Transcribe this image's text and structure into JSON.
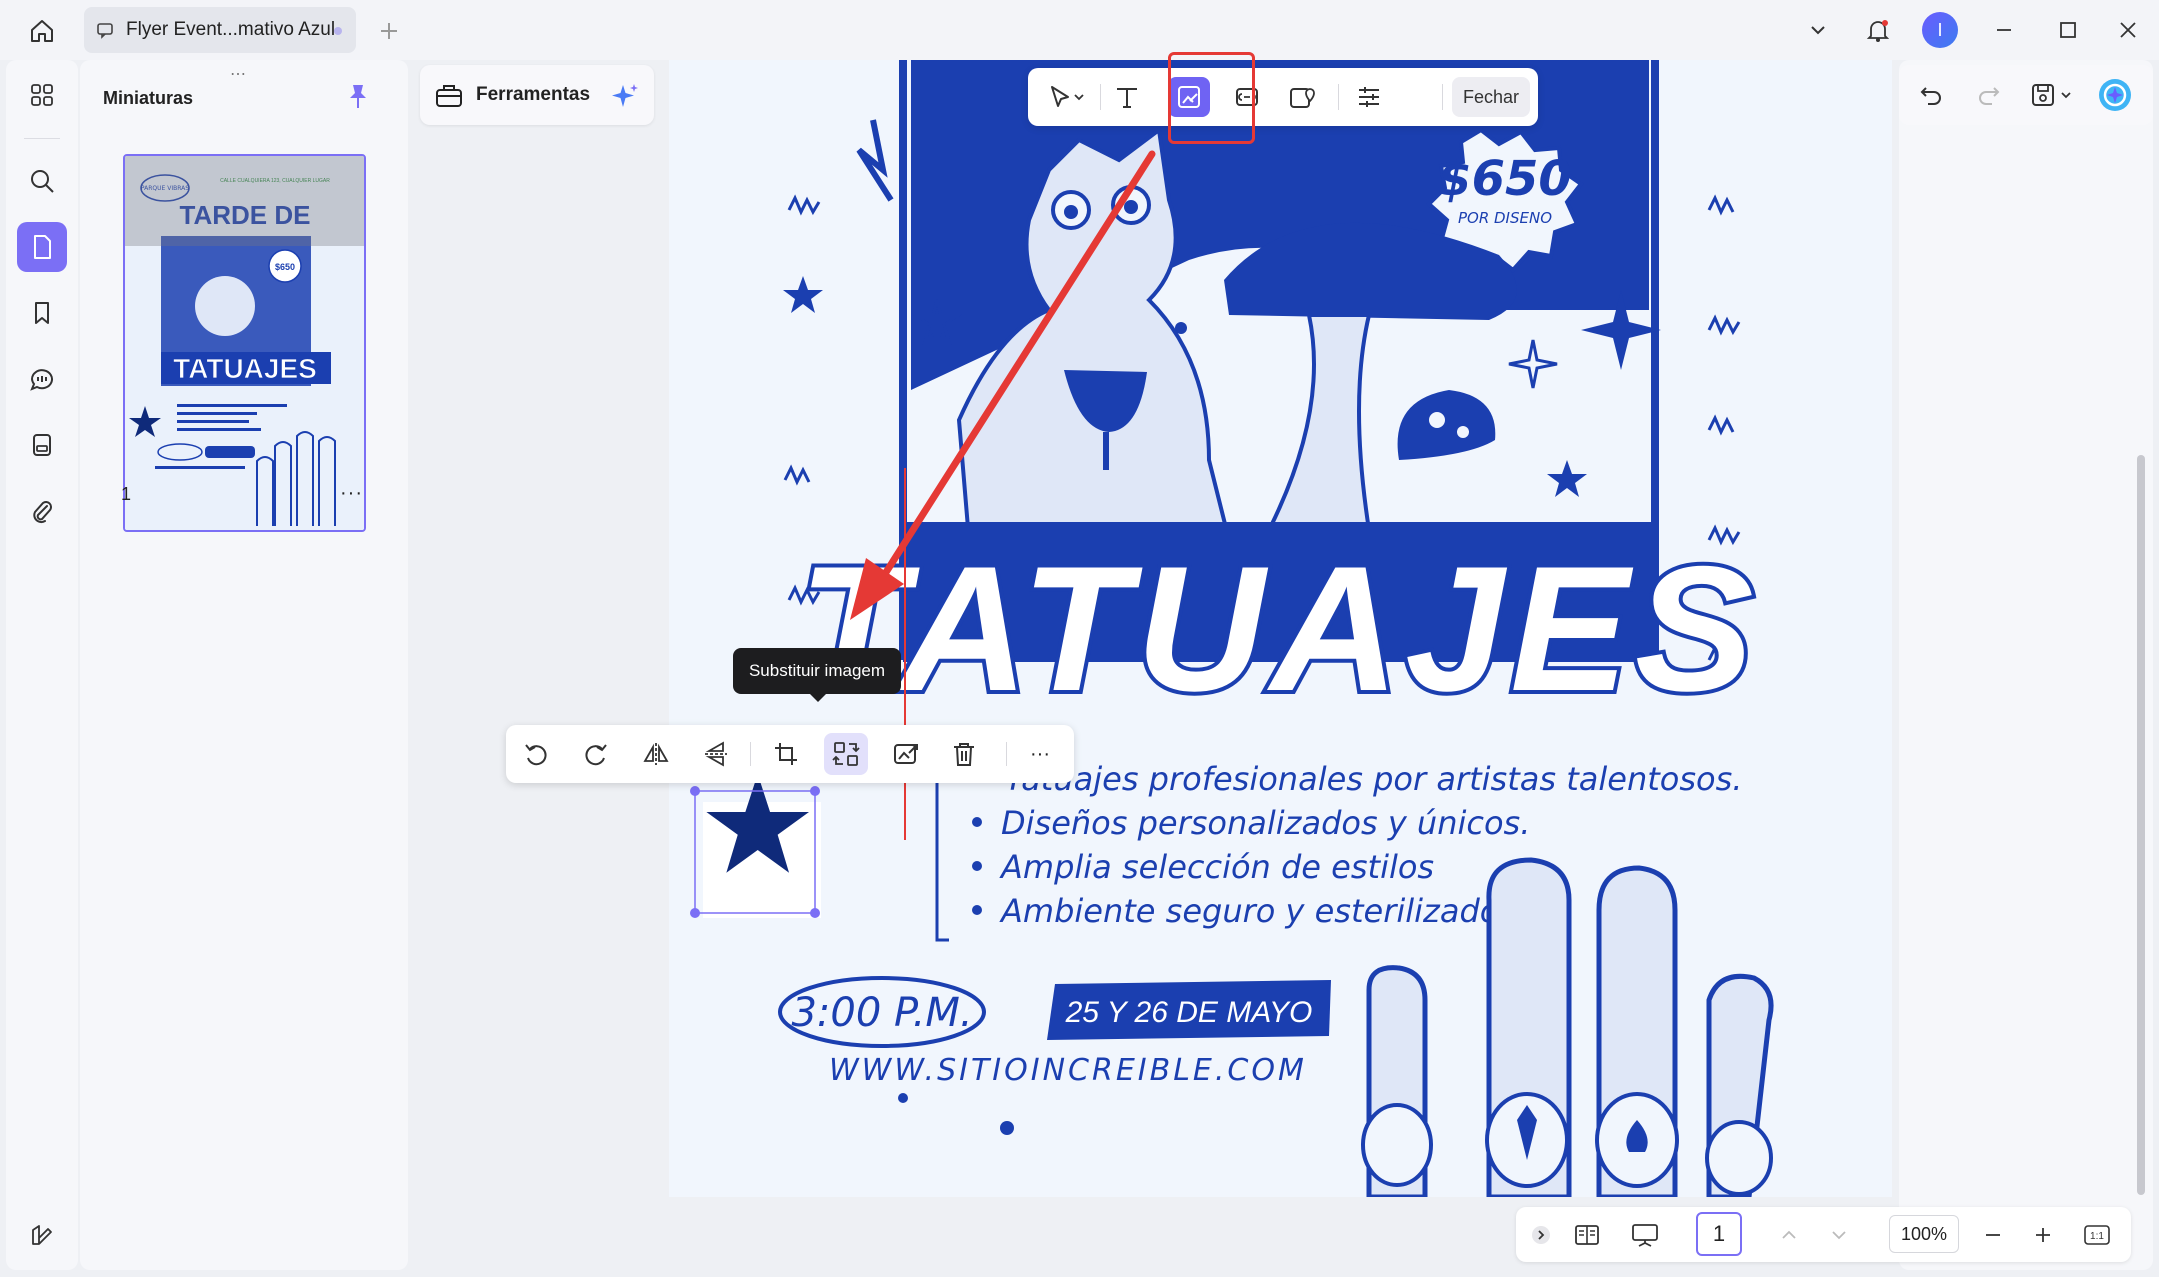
{
  "titlebar": {
    "tab_title": "Flyer Event...mativo Azul",
    "avatar_letter": "I"
  },
  "sidebar": {
    "panel_title": "Miniaturas",
    "page_number": "1",
    "more": "···"
  },
  "tools": {
    "label": "Ferramentas"
  },
  "edit_toolbar": {
    "close_label": "Fechar",
    "active_tool": "edit-image"
  },
  "image_toolbar": {
    "tooltip": "Substituir imagem",
    "more": "···"
  },
  "flyer": {
    "thumb_tag": "PARQUE VIBRAS",
    "thumb_address": "CALLE CUALQUIERA 123, CUALQUIER LUGAR",
    "thumb_heading": "TARDE DE",
    "price": "$650",
    "price_caption": "POR DISENO",
    "heading": "TATUAJES",
    "bullets": [
      "Tatuajes profesionales por artistas talentosos.",
      "Diseños personalizados y únicos.",
      "Amplia selección de estilos",
      "Ambiente seguro y esterilizado."
    ],
    "time": "3:00 P.M.",
    "dates": "25 Y 26 DE MAYO",
    "website": "WWW.SITIOINCREIBLE.COM"
  },
  "bottom_bar": {
    "page_value": "1",
    "zoom": "100%",
    "fit_label": "1:1"
  },
  "colors": {
    "accent": "#7b6ff5",
    "flyer_blue": "#1b3fb0",
    "annotation_red": "#e53935",
    "page_bg": "#f1f6fd"
  }
}
